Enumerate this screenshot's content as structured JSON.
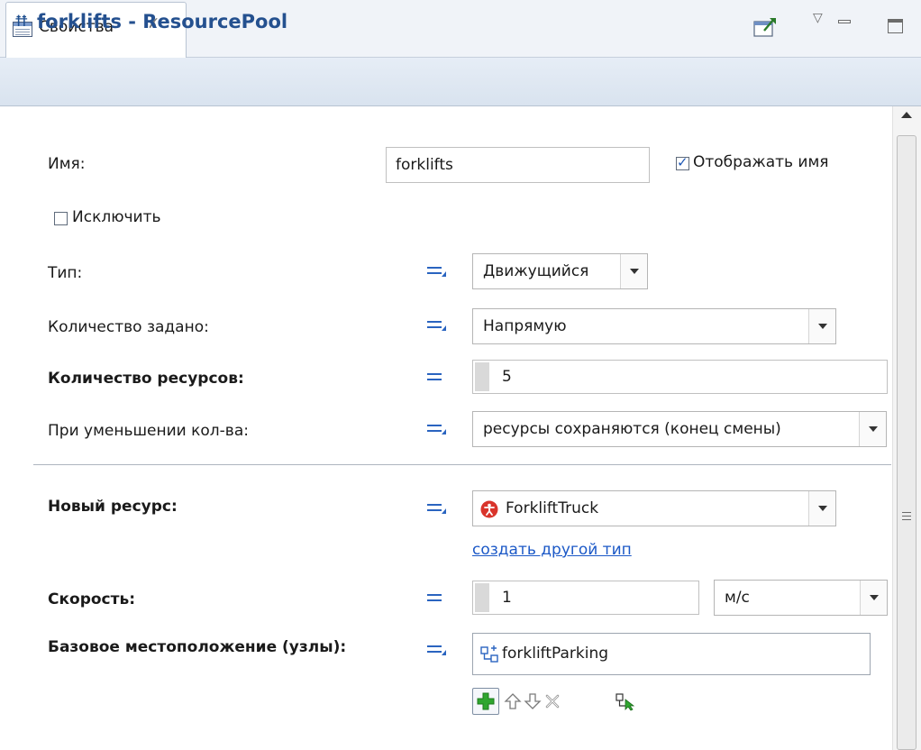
{
  "tab": {
    "title": "Свойства",
    "close_symbol": "✗"
  },
  "header": {
    "title": "forklifts - ResourcePool",
    "icon": "resource-pool-icon"
  },
  "form": {
    "name_label": "Имя:",
    "name_value": "forklifts",
    "show_name_label": "Отображать имя",
    "show_name_checked": true,
    "exclude_label": "Исключить",
    "exclude_checked": false,
    "type_label": "Тип:",
    "type_value": "Движущийся",
    "quantity_defined_label": "Количество задано:",
    "quantity_defined_value": "Напрямую",
    "resource_count_label": "Количество ресурсов:",
    "resource_count_value": "5",
    "on_decrease_label": "При уменьшении кол-ва:",
    "on_decrease_value": "ресурсы сохраняются (конец смены)",
    "new_resource_label": "Новый ресурс:",
    "new_resource_value": "ForkliftTruck",
    "create_type_link": "создать другой тип",
    "speed_label": "Скорость:",
    "speed_value": "1",
    "speed_unit": "м/с",
    "home_location_label": "Базовое местоположение (узлы):",
    "home_location_item": "forkliftParking"
  },
  "colors": {
    "accent_blue": "#2a64c0",
    "header_text": "#24508f",
    "link": "#1c59c7",
    "error_red": "#d9342b",
    "add_green": "#2fa62f"
  }
}
